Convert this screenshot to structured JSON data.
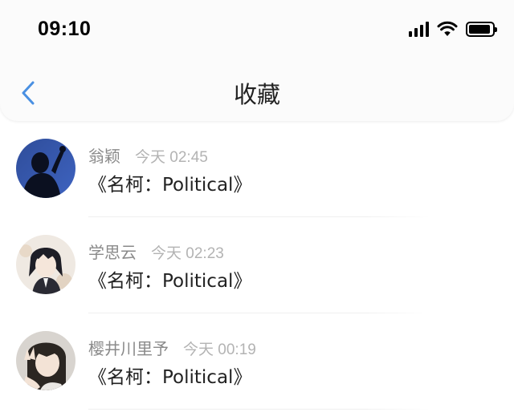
{
  "status_bar": {
    "time": "09:10",
    "icons": [
      "signal-icon",
      "wifi-icon",
      "battery-icon"
    ]
  },
  "nav": {
    "back_icon": "chevron-left-icon",
    "title": "收藏",
    "accent_color": "#4a90e2"
  },
  "favorites": [
    {
      "user": "翁颖",
      "time": "今天 02:45",
      "title": "《名柯：Political》",
      "avatar": "avatar-silhouette-blue"
    },
    {
      "user": "学思云",
      "time": "今天 02:23",
      "title": "《名柯：Political》",
      "avatar": "avatar-anime-dark-hair"
    },
    {
      "user": "樱井川里予",
      "time": "今天 00:19",
      "title": "《名柯：Political》",
      "avatar": "avatar-anime-peace-sign"
    }
  ]
}
